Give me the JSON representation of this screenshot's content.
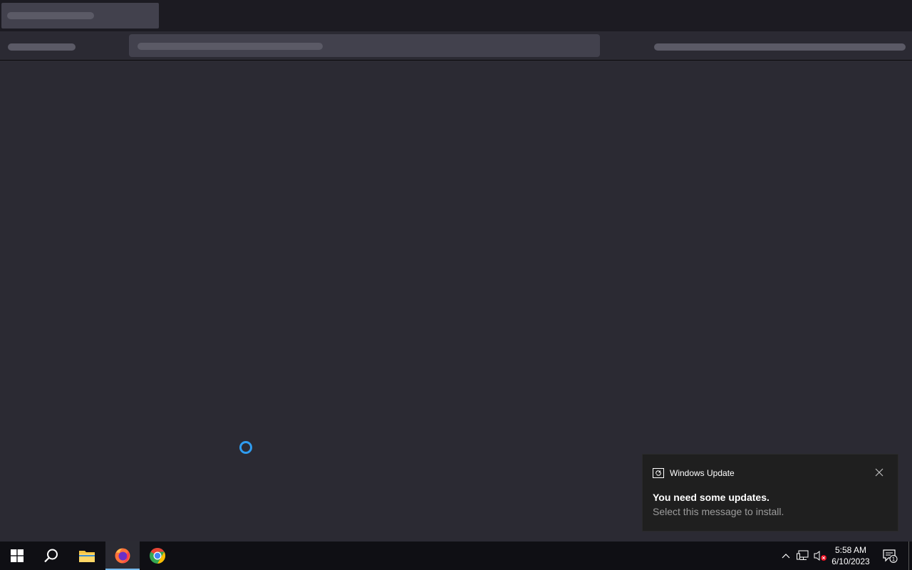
{
  "notification": {
    "app_name": "Windows Update",
    "title": "You need some updates.",
    "body": "Select this message to install."
  },
  "taskbar": {
    "clock_time": "5:58 AM",
    "clock_date": "6/10/2023",
    "action_center_badge": "1",
    "active_app": "firefox"
  },
  "colors": {
    "accent": "#76b9ed",
    "spinner": "#2f9cf0",
    "page_bg": "#2b2a33"
  }
}
